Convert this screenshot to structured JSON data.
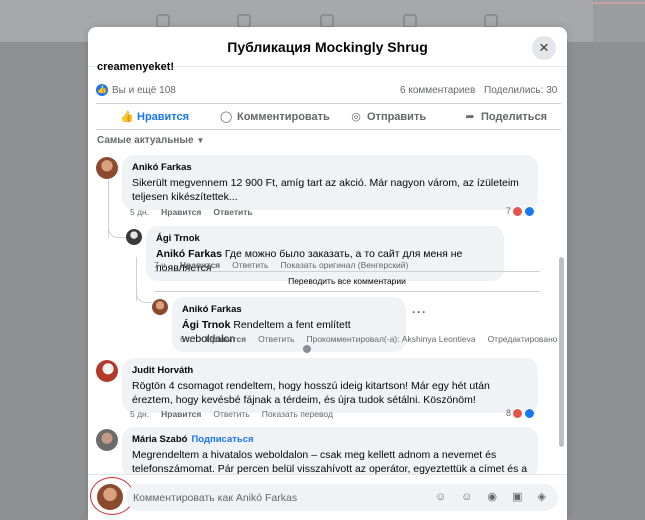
{
  "modal": {
    "title": "Публикация Mockingly Shrug",
    "close": "×"
  },
  "post": {
    "cut_text": "creamenyeket!",
    "reactions_text": "Вы и ещё 108",
    "comments_count": "6 комментариев",
    "shares_count": "Поделились: 30"
  },
  "actions": {
    "like": "Нравится",
    "comment": "Комментировать",
    "send": "Отправить",
    "share": "Поделиться"
  },
  "sort_label": "Самые актуальные",
  "comments": [
    {
      "author": "Anikó Farkas",
      "text": "Sikerült megvennem 12 900 Ft, amíg tart az akció. Már nagyon várom, az ízületeim teljesen kikészítettek...",
      "time": "5 дн.",
      "like": "Нравится",
      "reply": "Ответить",
      "react_count": "7"
    },
    {
      "author": "Ági Trnok",
      "mention": "Anikó Farkas",
      "text": "Где можно было заказать, а то сайт для меня не появляется",
      "time": "7 ч.",
      "like": "Нравится",
      "reply": "Ответить",
      "original": "Показать оригинал (Венгерский)"
    },
    {
      "author": "Anikó Farkas",
      "mention": "Ági Trnok",
      "text": "Rendeltem a fent említett weboldalon",
      "time": "6 ч.",
      "like": "Нравится",
      "reply": "Ответить",
      "commented_by": "Прокомментировал(-а): Akshinya Leontieva",
      "edited": "Отредактировано"
    },
    {
      "author": "Judit Horváth",
      "text": "Rögtön 4 csomagot rendeltem, hogy hosszú ideig kitartson! Már egy hét után éreztem, hogy kevésbé fájnak a térdeim, és újra tudok sétálni. Köszönöm!",
      "time": "5 дн.",
      "like": "Нравится",
      "reply": "Ответить",
      "translate": "Показать перевод",
      "react_count": "8"
    },
    {
      "author": "Mária Szabó",
      "follow": "Подписаться",
      "text": "Megrendeltem a hivatalos weboldalon – csak meg kellett adnom a nevemet és telefonszámomat. Pár percen belül visszahívott az operátor, egyeztettük a címet és a"
    }
  ],
  "translate_all": "Переводить все комментарии",
  "composer": {
    "placeholder": "Комментировать как Anikó Farkas",
    "tools": "☺ ☺ ◉ ▣ ◈"
  },
  "colors": {
    "accent": "#1877f2",
    "bubble": "#f0f2f5",
    "annotation_circle": "#d12a2a"
  }
}
